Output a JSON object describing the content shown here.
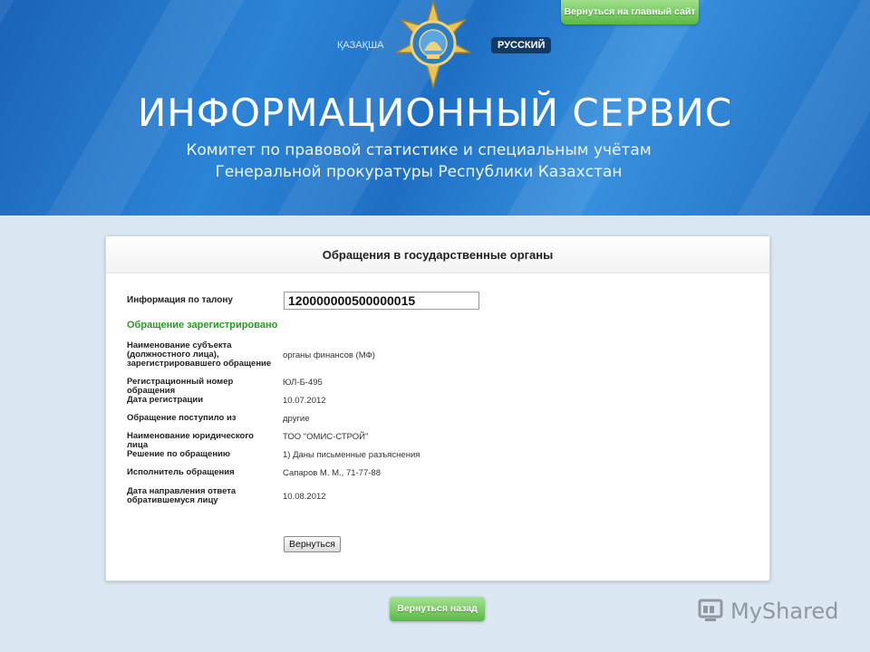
{
  "header": {
    "lang_kz": "ҚАЗАҚША",
    "lang_ru": "РУССКИЙ",
    "back_main_site": "Вернуться на главный сайт",
    "title": "ИНФОРМАЦИОННЫЙ СЕРВИС",
    "subtitle_line1": "Комитет по правовой статистике и специальным учётам",
    "subtitle_line2": "Генеральной прокуратуры Республики Казахстан"
  },
  "panel": {
    "title": "Обращения в государственные органы",
    "ticket_label": "Информация по талону",
    "ticket_value": "120000000500000015",
    "status": "Обращение зарегистрировано",
    "rows": [
      {
        "label": "Наименование субъекта (должностного лица), зарегистрировавшего обращение",
        "value": "органы финансов (МФ)"
      },
      {
        "label": "Регистрационный номер обращения",
        "value": "ЮЛ-Б-495"
      },
      {
        "label": "Дата регистрации",
        "value": "10.07.2012"
      },
      {
        "label": "Обращение поступило из",
        "value": "другие"
      },
      {
        "label": "Наименование юридического лица",
        "value": "ТОО \"ОМИС-СТРОЙ\""
      },
      {
        "label": "Решение по обращению",
        "value": "1) Даны письменные разъяснения"
      },
      {
        "label": "Исполнитель обращения",
        "value": "Сапаров М. М., 71-77-88"
      },
      {
        "label": "Дата направления ответа обратившемуся лицу",
        "value": "10.08.2012"
      }
    ],
    "back_button": "Вернуться"
  },
  "footer": {
    "back_button": "Вернуться назад"
  },
  "watermark": {
    "text": "MyShared"
  },
  "colors": {
    "header_blue": "#1e6fc4",
    "status_green": "#2a9a24",
    "button_green": "#5cb845"
  }
}
